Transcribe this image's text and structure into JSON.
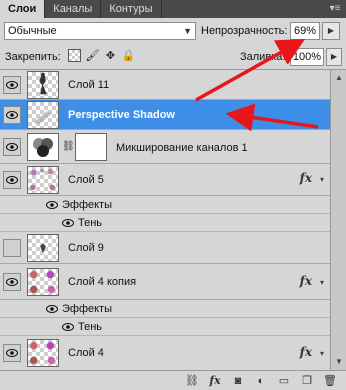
{
  "tabs": [
    {
      "label": "Слои",
      "active": true
    },
    {
      "label": "Каналы",
      "active": false
    },
    {
      "label": "Контуры",
      "active": false
    }
  ],
  "blend_mode": "Обычные",
  "opacity": {
    "label": "Непрозрачность:",
    "value": "69%"
  },
  "lock": {
    "label": "Закрепить:"
  },
  "fill": {
    "label": "Заливка:",
    "value": "100%"
  },
  "layers": [
    {
      "name": "Слой 11"
    },
    {
      "name": "Perspective Shadow",
      "selected": true
    },
    {
      "name": "Микширование каналов 1"
    },
    {
      "name": "Слой 5",
      "fx": "fx",
      "effects_label": "Эффекты",
      "effect": "Тень"
    },
    {
      "name": "Слой 9"
    },
    {
      "name": "Слой 4 копия",
      "fx": "fx",
      "effects_label": "Эффекты",
      "effect": "Тень"
    },
    {
      "name": "Слой 4",
      "fx": "fx"
    }
  ],
  "colors": {
    "selected": "#3d8ee6",
    "annotation_arrow": "#e8151b"
  }
}
